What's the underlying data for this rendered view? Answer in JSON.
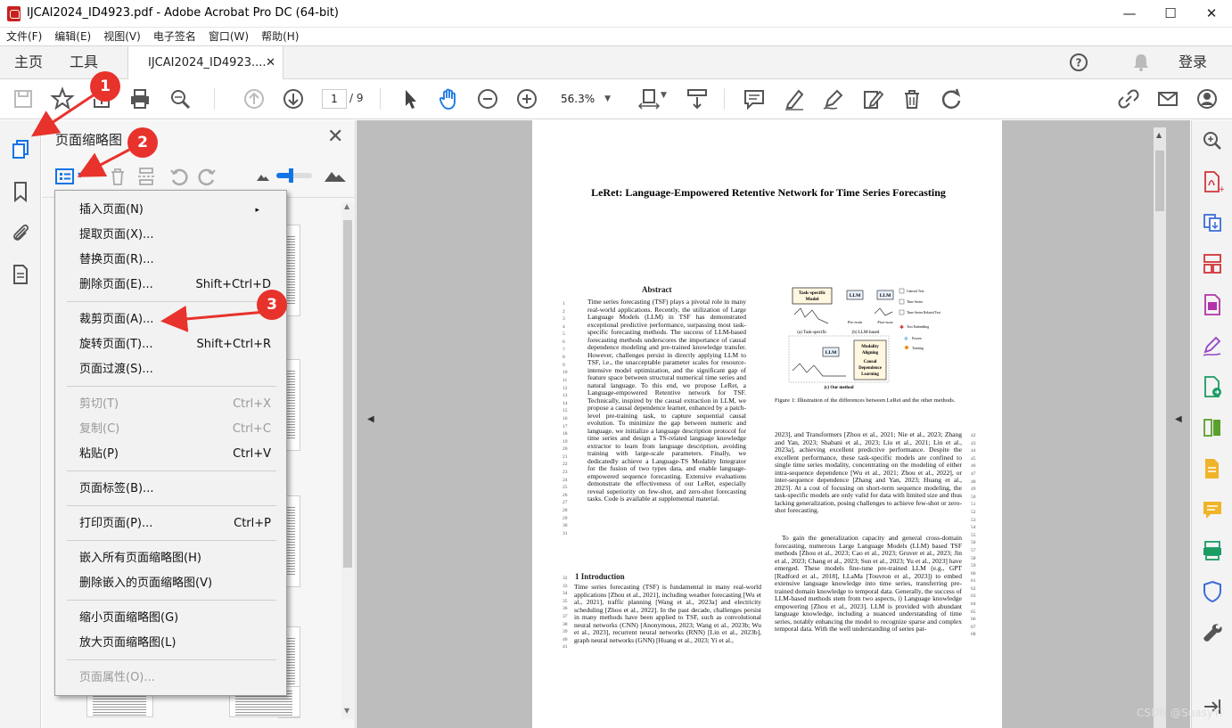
{
  "window": {
    "title": "IJCAI2024_ID4923.pdf - Adobe Acrobat Pro DC (64-bit)",
    "minimize": "—",
    "maximize": "☐",
    "close": "✕"
  },
  "menubar": [
    "文件(F)",
    "编辑(E)",
    "视图(V)",
    "电子签名",
    "窗口(W)",
    "帮助(H)"
  ],
  "tabs": {
    "home": "主页",
    "tools": "工具",
    "document": "IJCAI2024_ID4923....",
    "close": "✕",
    "signin": "登录"
  },
  "toolbar": {
    "page_current": "1",
    "page_total": "/ 9",
    "zoom": "56.3%"
  },
  "thumb_panel": {
    "title": "页面缩略图"
  },
  "context_menu": [
    {
      "label": "插入页面(N)",
      "shortcut": "",
      "submenu": "▸",
      "disabled": false
    },
    {
      "label": "提取页面(X)...",
      "shortcut": "",
      "disabled": false
    },
    {
      "label": "替换页面(R)...",
      "shortcut": "",
      "disabled": false
    },
    {
      "label": "删除页面(E)...",
      "shortcut": "Shift+Ctrl+D",
      "disabled": false
    },
    {
      "label": "裁剪页面(A)...",
      "shortcut": "",
      "disabled": false
    },
    {
      "label": "旋转页面(T)...",
      "shortcut": "Shift+Ctrl+R",
      "disabled": false
    },
    {
      "label": "页面过渡(S)...",
      "shortcut": "",
      "disabled": false
    },
    {
      "label": "剪切(T)",
      "shortcut": "Ctrl+X",
      "disabled": true
    },
    {
      "label": "复制(C)",
      "shortcut": "Ctrl+C",
      "disabled": true
    },
    {
      "label": "粘贴(P)",
      "shortcut": "Ctrl+V",
      "disabled": false
    },
    {
      "label": "页面标签(B)...",
      "shortcut": "",
      "disabled": false
    },
    {
      "label": "打印页面(P)...",
      "shortcut": "Ctrl+P",
      "disabled": false
    },
    {
      "label": "嵌入所有页面缩略图(H)",
      "shortcut": "",
      "disabled": false
    },
    {
      "label": "删除嵌入的页面缩略图(V)",
      "shortcut": "",
      "disabled": false
    },
    {
      "label": "缩小页面缩略图(G)",
      "shortcut": "",
      "disabled": false
    },
    {
      "label": "放大页面缩略图(L)",
      "shortcut": "",
      "disabled": false
    },
    {
      "label": "页面属性(O)...",
      "shortcut": "",
      "disabled": true
    }
  ],
  "annotations": {
    "step1": "1",
    "step2": "2",
    "step3": "3",
    "color": "#e8322c"
  },
  "paper": {
    "title": "LeRet: Language-Empowered Retentive Network for Time Series Forecasting",
    "abstract_heading": "Abstract",
    "abstract": "Time series forecasting (TSF) plays a pivotal role in many real-world applications. Recently, the utilization of Large Language Models (LLM) in TSF has demonstrated exceptional predictive performance, surpassing most task-specific forecasting methods. The success of LLM-based forecasting methods underscores the importance of causal dependence modeling and pre-trained knowledge transfer. However, challenges persist in directly applying LLM to TSF, i.e., the unacceptable parameter scales for resource-intensive model optimization, and the significant gap of feature space between structural numerical time series and natural language. To this end, we propose LeRet, a Language-empowered Retentive network for TSF. Technically, inspired by the causal extraction in LLM, we propose a causal dependence learner, enhanced by a patch-level pre-training task, to capture sequential causal evolution. To minimize the gap between numeric and language, we initialize a language description protocol for time series and design a TS-related language knowledge extractor to learn from language description, avoiding training with large-scale parameters. Finally, we dedicatedly achieve a Language-TS Modality Integrator for the fusion of two types data, and enable language-empowered sequence forecasting. Extensive evaluations demonstrate the effectiveness of our LeRet, especially reveal superiority on few-shot, and zero-shot forecasting tasks. Code is available at supplemental material.",
    "intro_heading": "1    Introduction",
    "intro": "Time series forecasting (TSF) is fundamental in many real-world applications [Zhou et al., 2021], including weather forecasting [Wu et al., 2021], traffic planning [Wang et al., 2023a] and electricity scheduling [Zhou et al., 2022]. In the past decade, challenges persist in many methods have been applied to TSF, such as convolutional neural networks (CNN) [Anonymous, 2023; Wang et al., 2023b; Wu et al., 2023], recurrent neural networks (RNN) [Lin et al., 2023b], graph neural networks (GNN) [Huang et al., 2023; Yi et al.,",
    "fig_caption": "Figure 1: Illustration of the differences between LeRet and the other methods.",
    "fig_labels": {
      "task_specific": "Task-specific Model",
      "llm": "LLM",
      "a": "(a) Task-specific",
      "b": "(b) LLM-based",
      "pretrain": "Pre-train",
      "finetune": "Fine-tune",
      "modality": "Modality Aligning",
      "causal": "Causal Dependence Learning",
      "c": "(c) Our method",
      "legend": [
        "General Text",
        "Time Series",
        "Time Series Related Text",
        "Text Embedding",
        "Frozen",
        "Training"
      ]
    },
    "right_col_1": "2023], and Transformers [Zhou et al., 2021; Nie et al., 2023; Zhang and Yan, 2023; Shabani et al., 2023; Liu et al., 2021; Lin et al., 2023a], achieving excellent predictive performance. Despite the excellent performance, these task-specific models are confined to single time series modality, concentrating on the modeling of either intra-sequence dependence [Wu et al., 2021; Zhou et al., 2022], or inter-sequence dependence [Zhang and Yan, 2023; Huang et al., 2023]. At a cost of focusing on short-term sequence modeling, the task-specific models are only valid for data with limited size and thus lacking generalization, posing challenges to achieve few-shot or zero-shot forecasting.",
    "right_col_2": "To gain the generalization capacity and general cross-domain forecasting, numerous Large Language Models (LLM) based TSF methods [Zhou et al., 2023; Cao et al., 2023; Gruver et al., 2023; Jin et al., 2023; Chang et al., 2023; Sun et al., 2023; Yu et al., 2023] have emerged. These models fine-tune pre-trained LLM (e.g., GPT [Radford et al., 2018], LLaMa [Touvron et al., 2023]) to embed extensive language knowledge into time series, transferring pre-trained domain knowledge to temporal data. Generally, the success of LLM-based methods stem from two aspects, i) Language knowledge empowering [Zhou et al., 2023]. LLM is provided with abundant language knowledge, including a nuanced understanding of time series, notably enhancing the model to recognize sparse and complex temporal data. With the well understanding of series pat-"
  },
  "watermark": "CSDN @SuasyYi"
}
